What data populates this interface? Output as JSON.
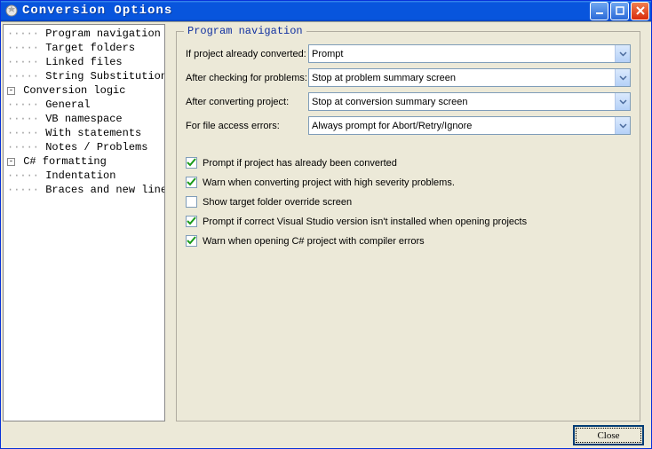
{
  "window": {
    "title": "Conversion Options"
  },
  "tree": [
    {
      "indent": 0,
      "pm": null,
      "lines": "·····",
      "label": "Program navigation"
    },
    {
      "indent": 0,
      "pm": null,
      "lines": "·····",
      "label": "Target folders"
    },
    {
      "indent": 0,
      "pm": null,
      "lines": "·····",
      "label": "Linked files"
    },
    {
      "indent": 0,
      "pm": null,
      "lines": "·····",
      "label": "String Substitution"
    },
    {
      "indent": 0,
      "pm": "-",
      "lines": "",
      "label": "Conversion logic"
    },
    {
      "indent": 1,
      "pm": null,
      "lines": "·····",
      "label": "General"
    },
    {
      "indent": 1,
      "pm": null,
      "lines": "·····",
      "label": "VB namespace"
    },
    {
      "indent": 1,
      "pm": null,
      "lines": "·····",
      "label": "With statements"
    },
    {
      "indent": 0,
      "pm": null,
      "lines": "·····",
      "label": "Notes / Problems"
    },
    {
      "indent": 0,
      "pm": "-",
      "lines": "",
      "label": "C# formatting"
    },
    {
      "indent": 1,
      "pm": null,
      "lines": "·····",
      "label": "Indentation"
    },
    {
      "indent": 1,
      "pm": null,
      "lines": "·····",
      "label": "Braces and new lines"
    }
  ],
  "panel": {
    "title": "Program navigation"
  },
  "dropdowns": [
    {
      "label": "If project already converted:",
      "value": "Prompt"
    },
    {
      "label": "After checking for problems:",
      "value": "Stop at problem summary screen"
    },
    {
      "label": "After converting project:",
      "value": "Stop at conversion summary screen"
    },
    {
      "label": "For file access errors:",
      "value": "Always prompt for Abort/Retry/Ignore"
    }
  ],
  "checkboxes": [
    {
      "checked": true,
      "label": "Prompt if project has already been converted"
    },
    {
      "checked": true,
      "label": "Warn when converting project with high severity problems."
    },
    {
      "checked": false,
      "label": "Show target folder override screen"
    },
    {
      "checked": true,
      "label": "Prompt if correct Visual Studio version isn't installed when opening projects"
    },
    {
      "checked": true,
      "label": "Warn when opening C# project with compiler errors"
    }
  ],
  "footer": {
    "close_label": "Close"
  }
}
